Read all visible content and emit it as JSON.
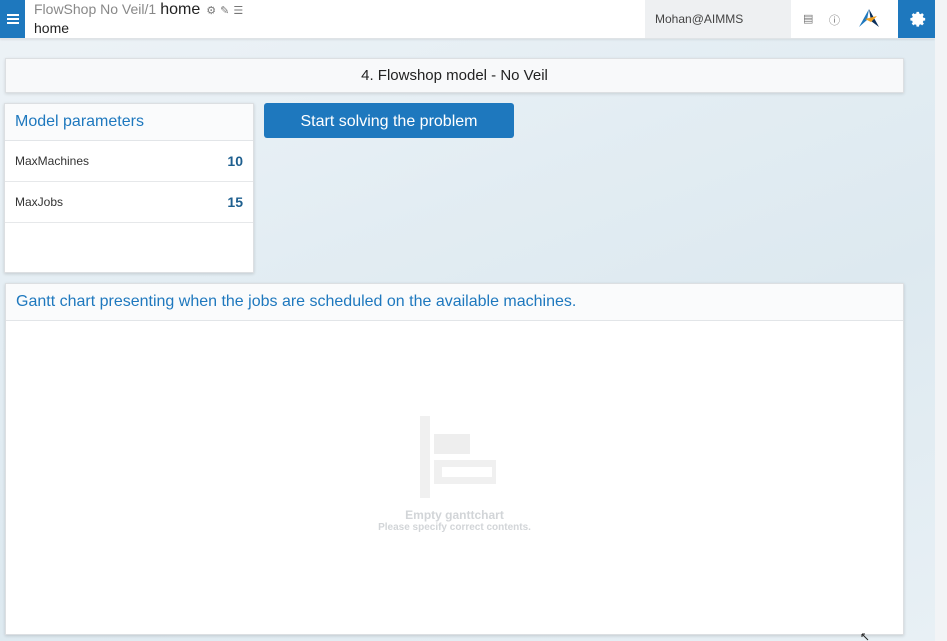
{
  "header": {
    "app_path": "FlowShop No Veil/1",
    "page_name": "home",
    "subtitle": "home",
    "user": "Mohan@AIMMS",
    "icons": [
      "menu-icon",
      "gear-small-icon",
      "pencil-icon",
      "list-icon",
      "chat-icon",
      "info-icon",
      "aimms-logo",
      "settings-gear-icon"
    ]
  },
  "page": {
    "title": "4. Flowshop model - No Veil"
  },
  "parameters": {
    "heading": "Model parameters",
    "rows": [
      {
        "label": "MaxMachines",
        "value": "10"
      },
      {
        "label": "MaxJobs",
        "value": "15"
      }
    ]
  },
  "actions": {
    "solve_label": "Start solving the problem"
  },
  "gantt": {
    "heading": "Gantt chart presenting when the jobs are scheduled on the available machines.",
    "empty_title": "Empty ganttchart",
    "empty_subtitle": "Please specify correct contents."
  },
  "colors": {
    "accent": "#1e78be",
    "value_text": "#1e5f8f"
  }
}
